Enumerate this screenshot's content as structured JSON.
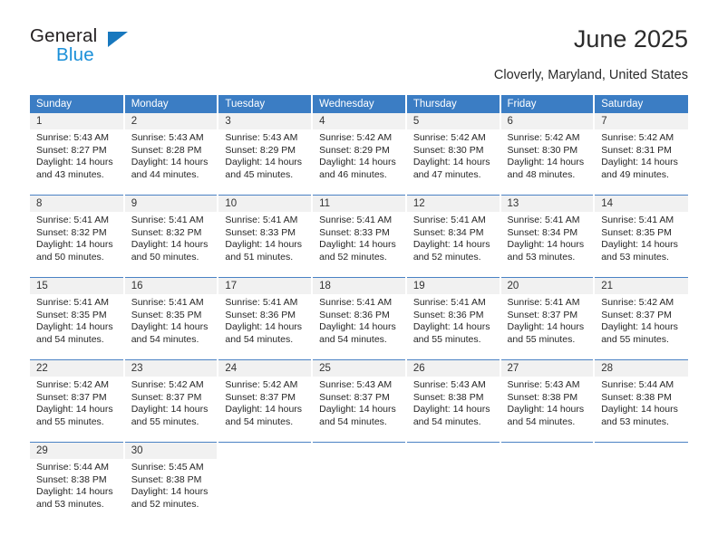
{
  "logo": {
    "word_one": "General",
    "word_two": "Blue",
    "triangle_color": "#1878be",
    "blue_color": "#1a8fd8"
  },
  "header": {
    "title": "June 2025",
    "location": "Cloverly, Maryland, United States"
  },
  "calendar": {
    "header_bg": "#3b7dc4",
    "daynum_bg": "#f1f1f1",
    "weekday_headers": [
      "Sunday",
      "Monday",
      "Tuesday",
      "Wednesday",
      "Thursday",
      "Friday",
      "Saturday"
    ],
    "weeks": [
      [
        {
          "day": "1",
          "sunrise": "Sunrise: 5:43 AM",
          "sunset": "Sunset: 8:27 PM",
          "daylight_1": "Daylight: 14 hours",
          "daylight_2": "and 43 minutes."
        },
        {
          "day": "2",
          "sunrise": "Sunrise: 5:43 AM",
          "sunset": "Sunset: 8:28 PM",
          "daylight_1": "Daylight: 14 hours",
          "daylight_2": "and 44 minutes."
        },
        {
          "day": "3",
          "sunrise": "Sunrise: 5:43 AM",
          "sunset": "Sunset: 8:29 PM",
          "daylight_1": "Daylight: 14 hours",
          "daylight_2": "and 45 minutes."
        },
        {
          "day": "4",
          "sunrise": "Sunrise: 5:42 AM",
          "sunset": "Sunset: 8:29 PM",
          "daylight_1": "Daylight: 14 hours",
          "daylight_2": "and 46 minutes."
        },
        {
          "day": "5",
          "sunrise": "Sunrise: 5:42 AM",
          "sunset": "Sunset: 8:30 PM",
          "daylight_1": "Daylight: 14 hours",
          "daylight_2": "and 47 minutes."
        },
        {
          "day": "6",
          "sunrise": "Sunrise: 5:42 AM",
          "sunset": "Sunset: 8:30 PM",
          "daylight_1": "Daylight: 14 hours",
          "daylight_2": "and 48 minutes."
        },
        {
          "day": "7",
          "sunrise": "Sunrise: 5:42 AM",
          "sunset": "Sunset: 8:31 PM",
          "daylight_1": "Daylight: 14 hours",
          "daylight_2": "and 49 minutes."
        }
      ],
      [
        {
          "day": "8",
          "sunrise": "Sunrise: 5:41 AM",
          "sunset": "Sunset: 8:32 PM",
          "daylight_1": "Daylight: 14 hours",
          "daylight_2": "and 50 minutes."
        },
        {
          "day": "9",
          "sunrise": "Sunrise: 5:41 AM",
          "sunset": "Sunset: 8:32 PM",
          "daylight_1": "Daylight: 14 hours",
          "daylight_2": "and 50 minutes."
        },
        {
          "day": "10",
          "sunrise": "Sunrise: 5:41 AM",
          "sunset": "Sunset: 8:33 PM",
          "daylight_1": "Daylight: 14 hours",
          "daylight_2": "and 51 minutes."
        },
        {
          "day": "11",
          "sunrise": "Sunrise: 5:41 AM",
          "sunset": "Sunset: 8:33 PM",
          "daylight_1": "Daylight: 14 hours",
          "daylight_2": "and 52 minutes."
        },
        {
          "day": "12",
          "sunrise": "Sunrise: 5:41 AM",
          "sunset": "Sunset: 8:34 PM",
          "daylight_1": "Daylight: 14 hours",
          "daylight_2": "and 52 minutes."
        },
        {
          "day": "13",
          "sunrise": "Sunrise: 5:41 AM",
          "sunset": "Sunset: 8:34 PM",
          "daylight_1": "Daylight: 14 hours",
          "daylight_2": "and 53 minutes."
        },
        {
          "day": "14",
          "sunrise": "Sunrise: 5:41 AM",
          "sunset": "Sunset: 8:35 PM",
          "daylight_1": "Daylight: 14 hours",
          "daylight_2": "and 53 minutes."
        }
      ],
      [
        {
          "day": "15",
          "sunrise": "Sunrise: 5:41 AM",
          "sunset": "Sunset: 8:35 PM",
          "daylight_1": "Daylight: 14 hours",
          "daylight_2": "and 54 minutes."
        },
        {
          "day": "16",
          "sunrise": "Sunrise: 5:41 AM",
          "sunset": "Sunset: 8:35 PM",
          "daylight_1": "Daylight: 14 hours",
          "daylight_2": "and 54 minutes."
        },
        {
          "day": "17",
          "sunrise": "Sunrise: 5:41 AM",
          "sunset": "Sunset: 8:36 PM",
          "daylight_1": "Daylight: 14 hours",
          "daylight_2": "and 54 minutes."
        },
        {
          "day": "18",
          "sunrise": "Sunrise: 5:41 AM",
          "sunset": "Sunset: 8:36 PM",
          "daylight_1": "Daylight: 14 hours",
          "daylight_2": "and 54 minutes."
        },
        {
          "day": "19",
          "sunrise": "Sunrise: 5:41 AM",
          "sunset": "Sunset: 8:36 PM",
          "daylight_1": "Daylight: 14 hours",
          "daylight_2": "and 55 minutes."
        },
        {
          "day": "20",
          "sunrise": "Sunrise: 5:41 AM",
          "sunset": "Sunset: 8:37 PM",
          "daylight_1": "Daylight: 14 hours",
          "daylight_2": "and 55 minutes."
        },
        {
          "day": "21",
          "sunrise": "Sunrise: 5:42 AM",
          "sunset": "Sunset: 8:37 PM",
          "daylight_1": "Daylight: 14 hours",
          "daylight_2": "and 55 minutes."
        }
      ],
      [
        {
          "day": "22",
          "sunrise": "Sunrise: 5:42 AM",
          "sunset": "Sunset: 8:37 PM",
          "daylight_1": "Daylight: 14 hours",
          "daylight_2": "and 55 minutes."
        },
        {
          "day": "23",
          "sunrise": "Sunrise: 5:42 AM",
          "sunset": "Sunset: 8:37 PM",
          "daylight_1": "Daylight: 14 hours",
          "daylight_2": "and 55 minutes."
        },
        {
          "day": "24",
          "sunrise": "Sunrise: 5:42 AM",
          "sunset": "Sunset: 8:37 PM",
          "daylight_1": "Daylight: 14 hours",
          "daylight_2": "and 54 minutes."
        },
        {
          "day": "25",
          "sunrise": "Sunrise: 5:43 AM",
          "sunset": "Sunset: 8:37 PM",
          "daylight_1": "Daylight: 14 hours",
          "daylight_2": "and 54 minutes."
        },
        {
          "day": "26",
          "sunrise": "Sunrise: 5:43 AM",
          "sunset": "Sunset: 8:38 PM",
          "daylight_1": "Daylight: 14 hours",
          "daylight_2": "and 54 minutes."
        },
        {
          "day": "27",
          "sunrise": "Sunrise: 5:43 AM",
          "sunset": "Sunset: 8:38 PM",
          "daylight_1": "Daylight: 14 hours",
          "daylight_2": "and 54 minutes."
        },
        {
          "day": "28",
          "sunrise": "Sunrise: 5:44 AM",
          "sunset": "Sunset: 8:38 PM",
          "daylight_1": "Daylight: 14 hours",
          "daylight_2": "and 53 minutes."
        }
      ],
      [
        {
          "day": "29",
          "sunrise": "Sunrise: 5:44 AM",
          "sunset": "Sunset: 8:38 PM",
          "daylight_1": "Daylight: 14 hours",
          "daylight_2": "and 53 minutes."
        },
        {
          "day": "30",
          "sunrise": "Sunrise: 5:45 AM",
          "sunset": "Sunset: 8:38 PM",
          "daylight_1": "Daylight: 14 hours",
          "daylight_2": "and 52 minutes."
        },
        {
          "day": "",
          "sunrise": "",
          "sunset": "",
          "daylight_1": "",
          "daylight_2": ""
        },
        {
          "day": "",
          "sunrise": "",
          "sunset": "",
          "daylight_1": "",
          "daylight_2": ""
        },
        {
          "day": "",
          "sunrise": "",
          "sunset": "",
          "daylight_1": "",
          "daylight_2": ""
        },
        {
          "day": "",
          "sunrise": "",
          "sunset": "",
          "daylight_1": "",
          "daylight_2": ""
        },
        {
          "day": "",
          "sunrise": "",
          "sunset": "",
          "daylight_1": "",
          "daylight_2": ""
        }
      ]
    ]
  }
}
